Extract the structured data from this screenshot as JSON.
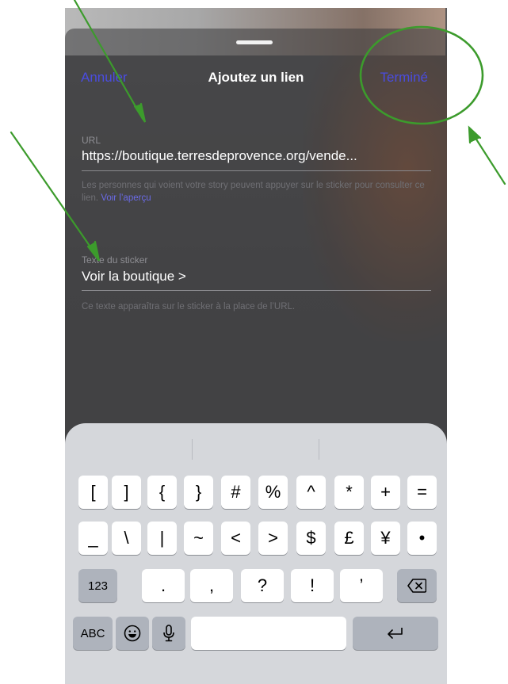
{
  "sheet": {
    "nav": {
      "cancel_label": "Annuler",
      "title": "Ajoutez un lien",
      "done_label": "Terminé"
    },
    "url_field": {
      "label": "URL",
      "value": "https://boutique.terresdeprovence.org/vende...",
      "helper_text": "Les personnes qui voient votre story peuvent appuyer sur le sticker pour consulter ce lien.",
      "preview_link": "Voir l’aperçu"
    },
    "sticker_field": {
      "label": "Texte du sticker",
      "value": "Voir la boutique >",
      "helper_text": "Ce texte apparaîtra sur le sticker à la place de l’URL."
    }
  },
  "keyboard": {
    "row1": [
      "[",
      "]",
      "{",
      "}",
      "#",
      "%",
      "^",
      "*",
      "+",
      "="
    ],
    "row2": [
      "_",
      "\\",
      "|",
      "~",
      "<",
      ">",
      "$",
      "£",
      "¥",
      "•"
    ],
    "row3": [
      ".",
      ",",
      "?",
      "!",
      "’"
    ],
    "numbers_label": "123",
    "abc_label": "ABC"
  },
  "colors": {
    "accent": "#4a4ce0",
    "annotation": "#3c9b2c"
  }
}
